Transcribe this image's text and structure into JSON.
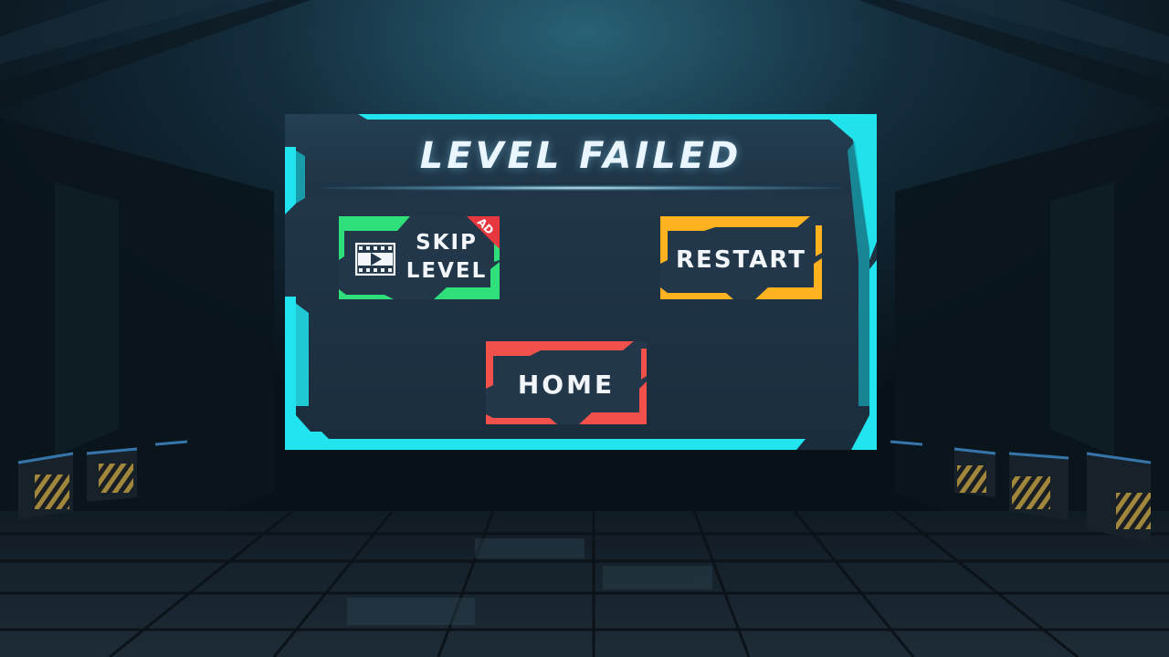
{
  "dialog": {
    "title": "LEVEL FAILED",
    "accent_color": "#22e4ee"
  },
  "buttons": {
    "skip": {
      "line1": "SKIP",
      "line2": "LEVEL",
      "badge": "AD",
      "icon": "video-icon",
      "accent_color": "#2fe07a"
    },
    "restart": {
      "label": "RESTART",
      "accent_color": "#ffb21f"
    },
    "home": {
      "label": "HOME",
      "accent_color": "#f2504a"
    }
  }
}
